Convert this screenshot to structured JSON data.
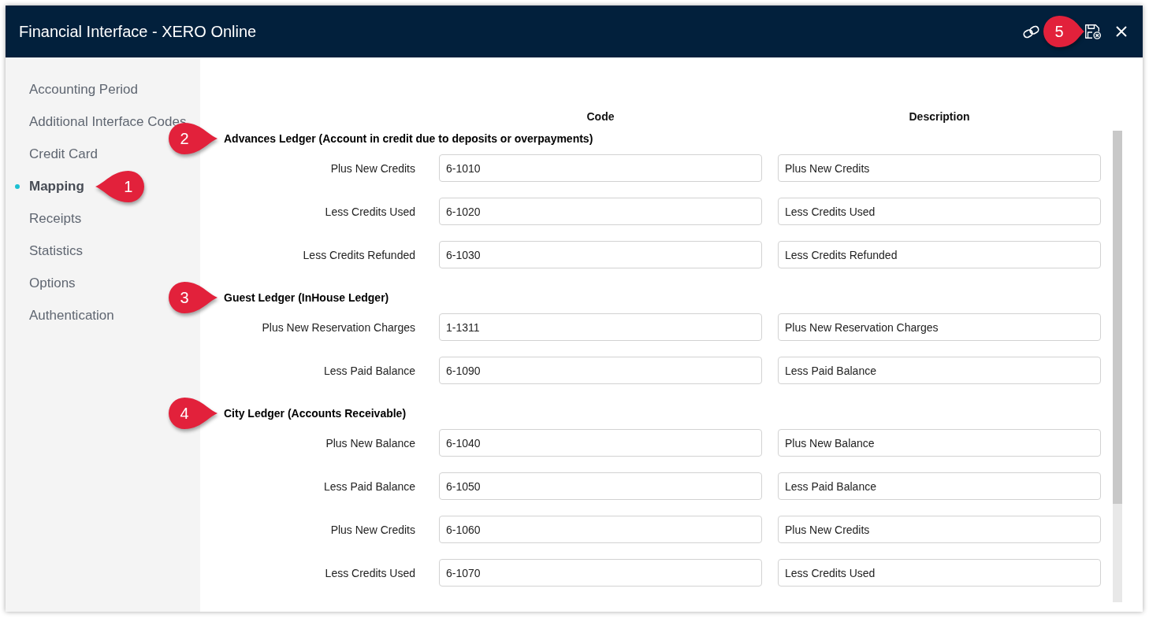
{
  "header": {
    "title": "Financial Interface - XERO Online",
    "callout": "5"
  },
  "sidebar": {
    "items": [
      {
        "label": "Accounting Period",
        "selected": false
      },
      {
        "label": "Additional Interface Codes",
        "selected": false
      },
      {
        "label": "Credit Card",
        "selected": false
      },
      {
        "label": "Mapping",
        "selected": true,
        "callout": "1"
      },
      {
        "label": "Receipts",
        "selected": false
      },
      {
        "label": "Statistics",
        "selected": false
      },
      {
        "label": "Options",
        "selected": false
      },
      {
        "label": "Authentication",
        "selected": false
      }
    ]
  },
  "columns": [
    "Code",
    "Description"
  ],
  "sections": [
    {
      "title": "Advances Ledger (Account in credit due to deposits or overpayments)",
      "callout": "2",
      "rows": [
        {
          "label": "Plus New Credits",
          "code": "6-1010",
          "description": "Plus New Credits"
        },
        {
          "label": "Less Credits Used",
          "code": "6-1020",
          "description": "Less Credits Used"
        },
        {
          "label": "Less Credits Refunded",
          "code": "6-1030",
          "description": "Less Credits Refunded"
        }
      ]
    },
    {
      "title": "Guest Ledger (InHouse Ledger)",
      "callout": "3",
      "rows": [
        {
          "label": "Plus New Reservation Charges",
          "code": "1-1311",
          "description": "Plus New Reservation Charges"
        },
        {
          "label": "Less Paid Balance",
          "code": "6-1090",
          "description": "Less Paid Balance"
        }
      ]
    },
    {
      "title": "City Ledger (Accounts Receivable)",
      "callout": "4",
      "rows": [
        {
          "label": "Plus New Balance",
          "code": "6-1040",
          "description": "Plus New Balance"
        },
        {
          "label": "Less Paid Balance",
          "code": "6-1050",
          "description": "Less Paid Balance"
        },
        {
          "label": "Plus New Credits",
          "code": "6-1060",
          "description": "Plus New Credits"
        },
        {
          "label": "Less Credits Used",
          "code": "6-1070",
          "description": "Less Credits Used"
        }
      ]
    }
  ]
}
